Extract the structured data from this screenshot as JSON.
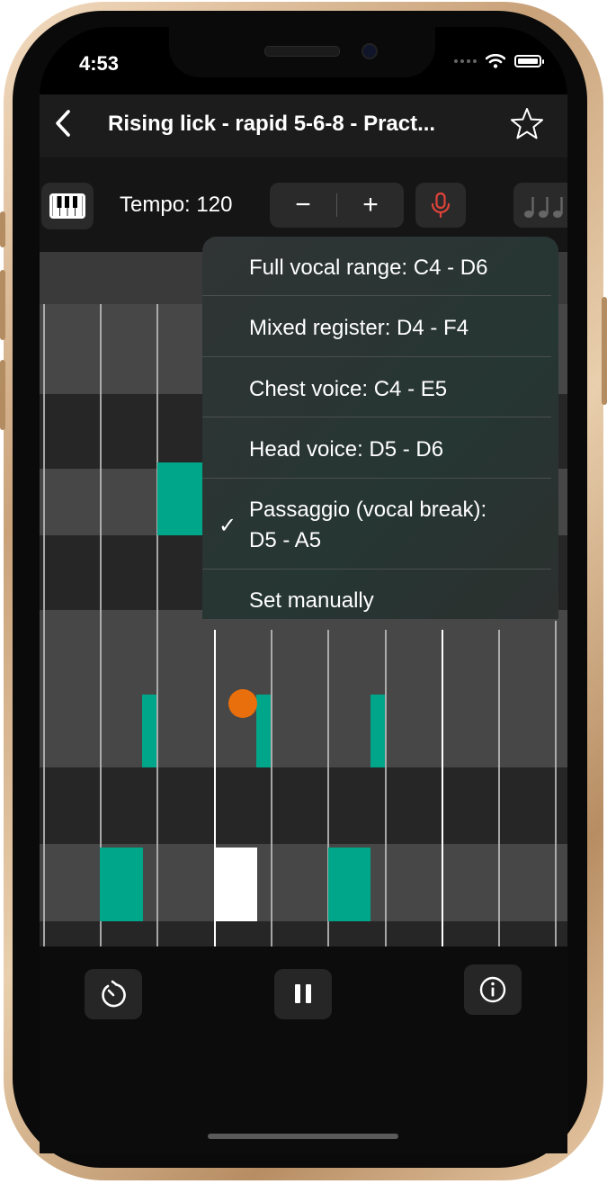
{
  "status": {
    "time": "4:53"
  },
  "nav": {
    "title": "Rising lick - rapid 5-6-8 - Pract..."
  },
  "toolbar": {
    "tempo_label": "Tempo: 120",
    "minus": "−",
    "plus": "+"
  },
  "menu": {
    "items": [
      {
        "label": "Full vocal range: C4 - D6",
        "checked": false
      },
      {
        "label": "Mixed register: D4 - F4",
        "checked": false
      },
      {
        "label": "Chest voice: C4 - E5",
        "checked": false
      },
      {
        "label": "Head voice: D5 - D6",
        "checked": false
      },
      {
        "label_line1": "Passaggio (vocal break):",
        "label_line2": "D5 - A5",
        "checked": true
      },
      {
        "label": "Set manually",
        "checked": false
      }
    ],
    "check_mark": "✓"
  },
  "colors": {
    "note": "#00a68a",
    "playhead_dot": "#e86f0c",
    "mic": "#e0433a",
    "current_note": "#ffffff"
  }
}
